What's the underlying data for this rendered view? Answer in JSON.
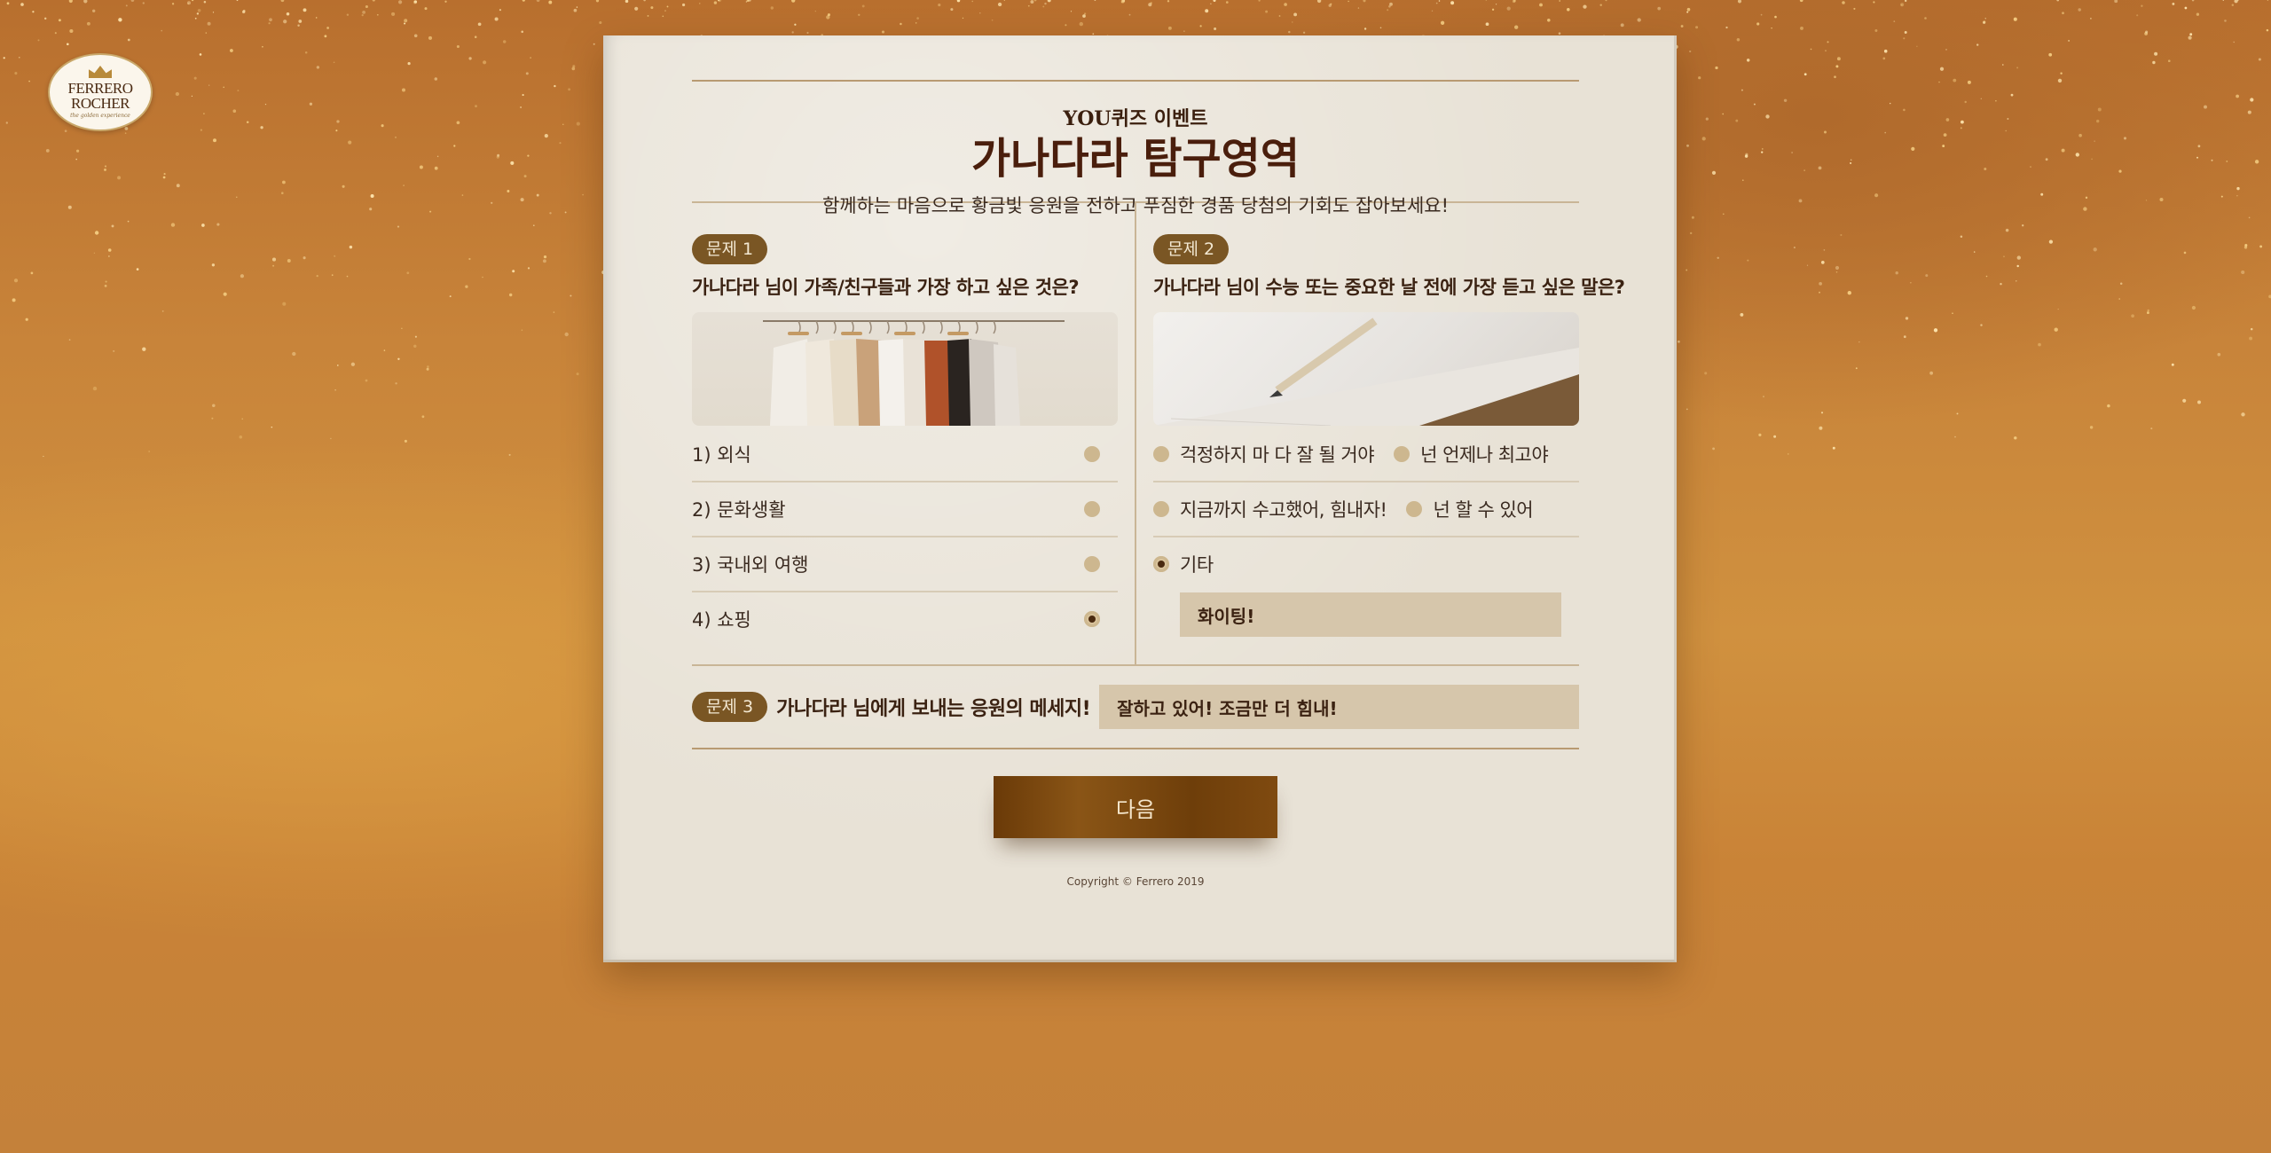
{
  "brand": {
    "line1": "FERRERO",
    "line2": "ROCHER",
    "tagline": "the golden experience"
  },
  "header": {
    "eyebrow": "YOU퀴즈 이벤트",
    "title": "가나다라 탐구영역",
    "subtitle": "함께하는 마음으로 황금빛 응원을 전하고 푸짐한 경품 당첨의 기회도 잡아보세요!"
  },
  "q1": {
    "badge": "문제 1",
    "question": "가나다라 님이 가족/친구들과 가장 하고 싶은 것은?",
    "image": "clothes-rack-photo",
    "options": [
      {
        "label": "1) 외식",
        "selected": false
      },
      {
        "label": "2) 문화생활",
        "selected": false
      },
      {
        "label": "3) 국내외 여행",
        "selected": false
      },
      {
        "label": "4) 쇼핑",
        "selected": true
      }
    ]
  },
  "q2": {
    "badge": "문제 2",
    "question": "가나다라 님이 수능 또는 중요한 날 전에 가장 듣고 싶은 말은?",
    "image": "pencil-notebook-photo",
    "options": [
      {
        "label": "걱정하지 마 다 잘 될 거야",
        "selected": false
      },
      {
        "label": "넌 언제나 최고야",
        "selected": false
      },
      {
        "label": "지금까지 수고했어, 힘내자!",
        "selected": false
      },
      {
        "label": "넌 할 수 있어",
        "selected": false
      },
      {
        "label": "기타",
        "selected": true
      }
    ],
    "etc_value": "화이팅!"
  },
  "q3": {
    "badge": "문제 3",
    "question": "가나다라 님에게 보내는 응원의 메세지!",
    "value": "잘하고 있어! 조금만 더 힘내!"
  },
  "next_label": "다음",
  "copyright": "Copyright © Ferrero 2019",
  "colors": {
    "badge": "#7a5624",
    "button": "#7a4510",
    "paper": "#e8e2d6",
    "input": "#d6c6ab"
  }
}
